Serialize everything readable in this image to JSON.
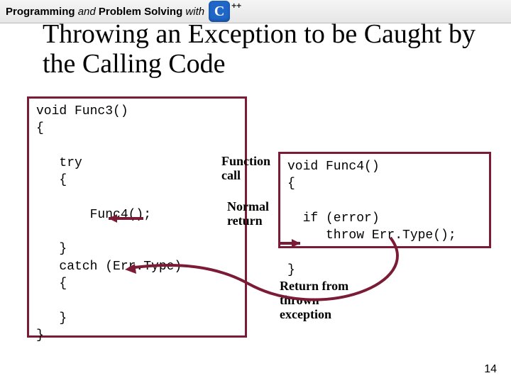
{
  "banner": {
    "word1": "Programming",
    "word2": "and",
    "word3": "Problem Solving",
    "word4": "with",
    "logo_letter": "C",
    "logo_suffix": "++"
  },
  "title": "Throwing an Exception to be Caught by the Calling Code",
  "code_left": "void Func3()\n{\n\n   try\n   {\n\n       Func4();\n\n   }\n   catch (Err.Type)\n   {\n\n   }\n}",
  "code_right": "void Func4()\n{\n\n  if (error)\n     throw Err.Type();\n\n}",
  "labels": {
    "function_call": "Function\ncall",
    "normal_return": "Normal\nreturn",
    "return_thrown": "Return from\nthrown\nexception"
  },
  "slide_number": "14"
}
